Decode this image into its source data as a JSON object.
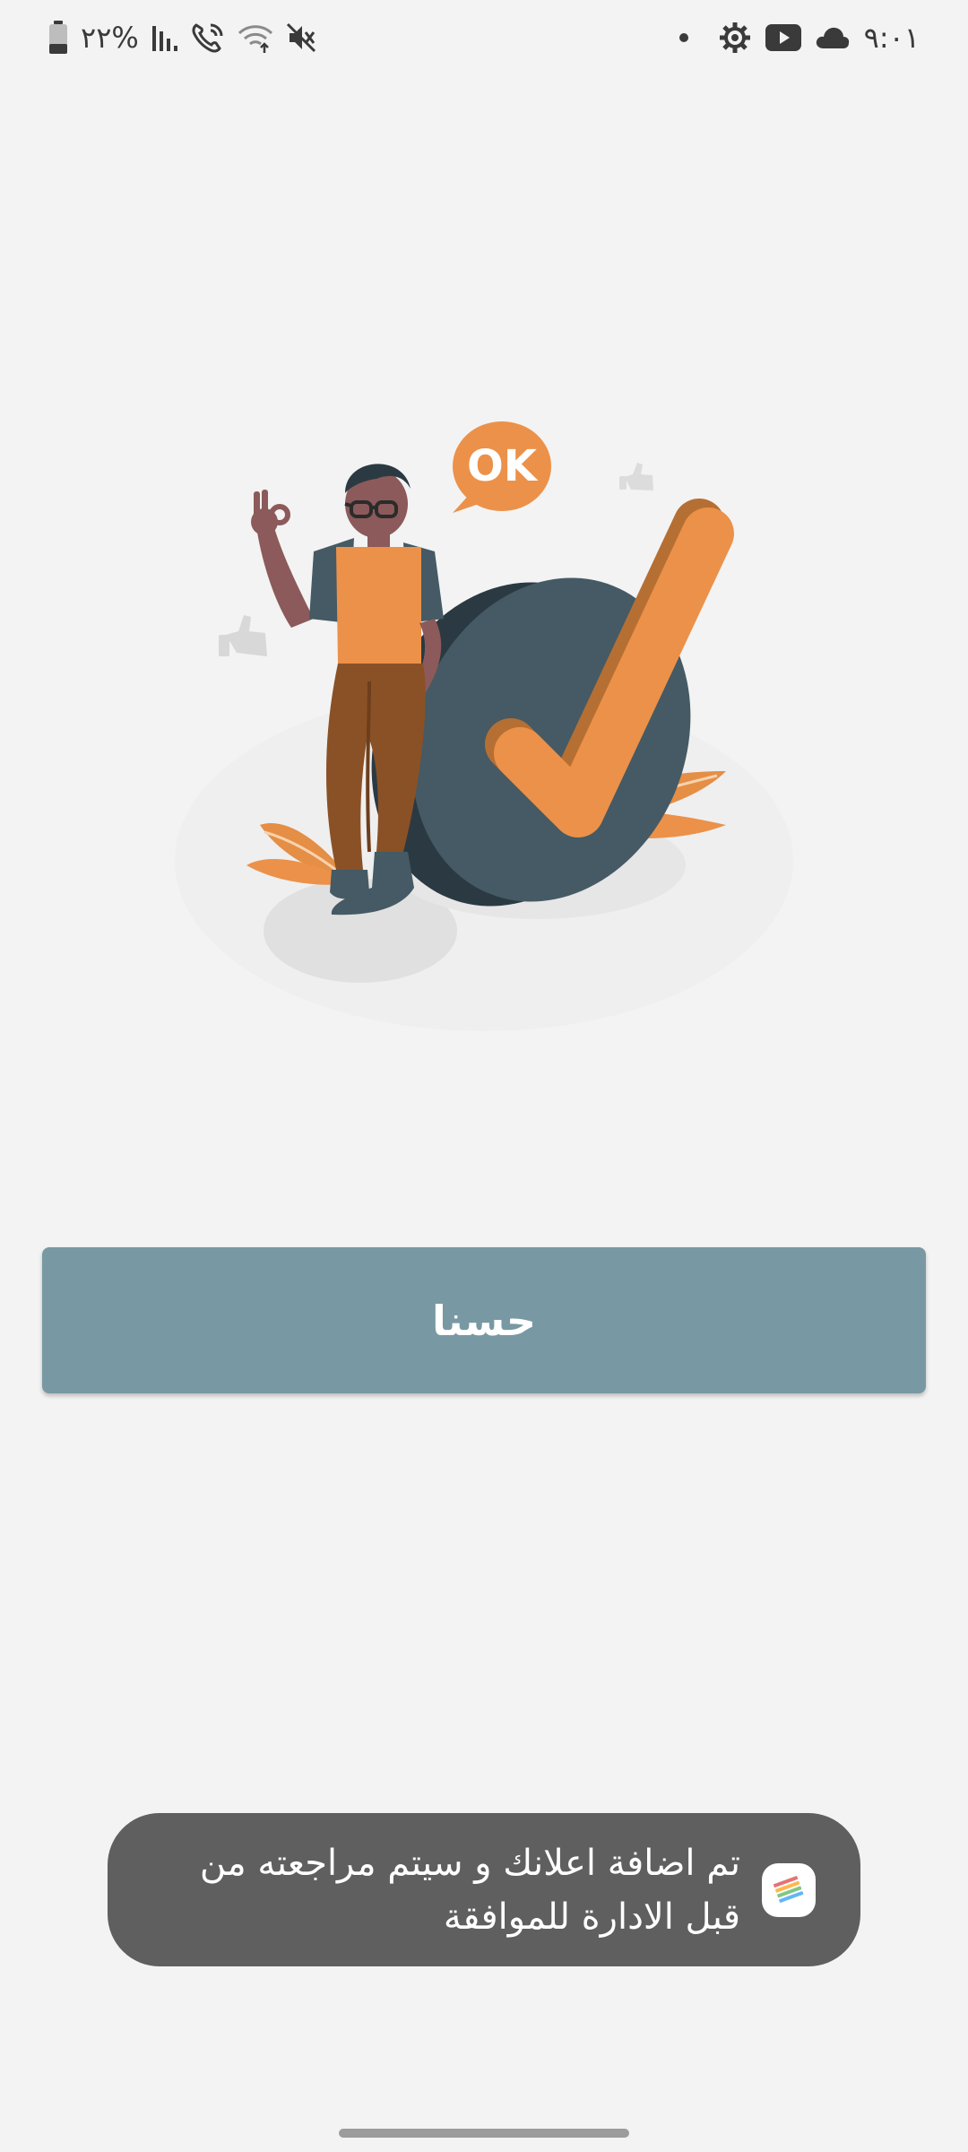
{
  "status_bar": {
    "time": "٩:٠١",
    "battery_percent": "٢٢%",
    "icons_right": [
      "settings-icon",
      "youtube-icon",
      "cloud-icon"
    ],
    "icons_left": [
      "battery-icon",
      "signal-icon",
      "wifi-calling-icon",
      "wifi-icon",
      "mute-icon"
    ]
  },
  "illustration": {
    "speech_bubble_text": "OK",
    "accent_color": "#ec9149",
    "dark_color": "#455a64"
  },
  "main": {
    "confirm_button_label": "حسنا",
    "button_color": "#7899a3"
  },
  "toast": {
    "line1": "تم اضافة اعلانك و سيتم مراجعته من",
    "line2": "قبل الادارة للموافقة",
    "background": "#5f5f5f"
  }
}
